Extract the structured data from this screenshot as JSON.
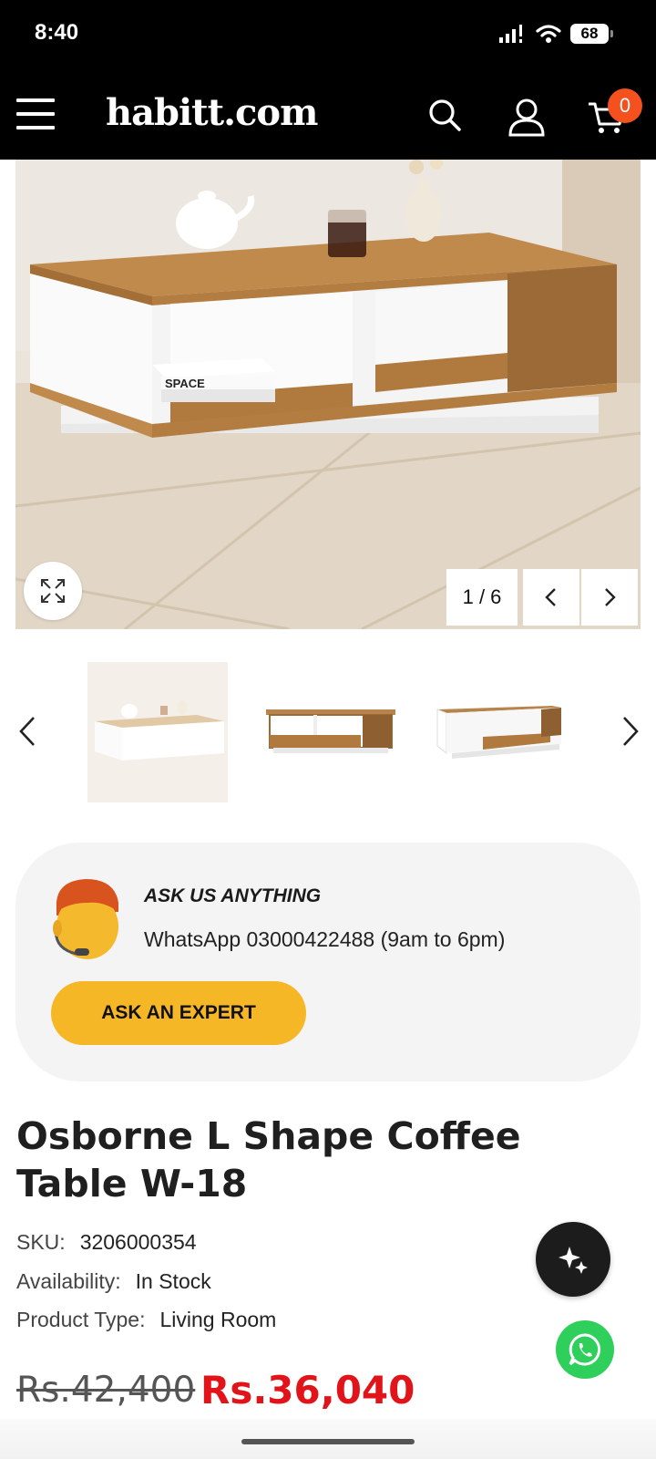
{
  "status_bar": {
    "time": "8:40",
    "battery": "68"
  },
  "header": {
    "logo": "habitt.com",
    "cart_count": "0"
  },
  "gallery": {
    "main_image_text": "SPACE",
    "counter": "1 / 6"
  },
  "ask": {
    "title": "ASK US ANYTHING",
    "phone": "WhatsApp 03000422488 (9am to 6pm)",
    "button": "ASK AN EXPERT"
  },
  "product": {
    "title": "Osborne L Shape Coffee Table W-18",
    "sku_label": "SKU:",
    "sku": "3206000354",
    "availability_label": "Availability:",
    "availability": "In Stock",
    "type_label": "Product Type:",
    "type": "Living Room",
    "old_price": "Rs.42,400",
    "new_price": "Rs.36,040"
  },
  "colors": {
    "header_bg": "#000000",
    "badge": "#f4511e",
    "expert_button": "#f6b726",
    "sale_price": "#e1141a",
    "whatsapp": "#2fcf5b"
  },
  "icons": [
    "signal-icon",
    "wifi-icon",
    "battery-icon",
    "menu-icon",
    "search-icon",
    "user-icon",
    "cart-icon",
    "expand-icon",
    "chevron-left-icon",
    "chevron-right-icon",
    "support-agent-icon",
    "sparkle-icon",
    "whatsapp-icon"
  ]
}
